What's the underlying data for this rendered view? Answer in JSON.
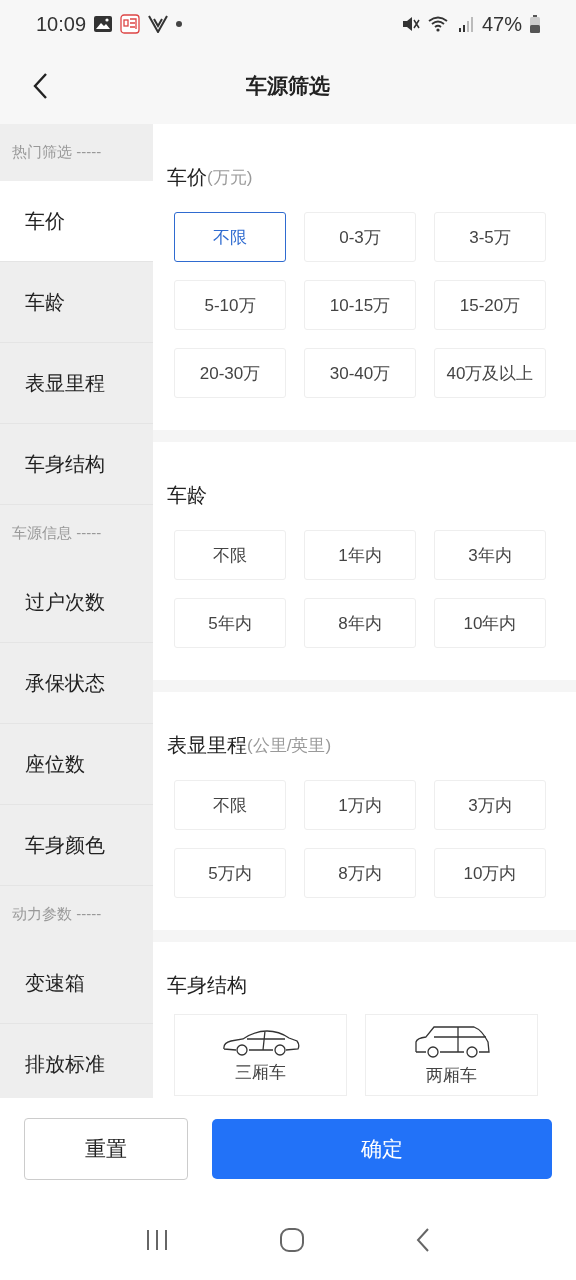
{
  "status_bar": {
    "time": "10:09",
    "battery": "47%"
  },
  "header": {
    "title": "车源筛选"
  },
  "sidebar": {
    "items": [
      {
        "kind": "group",
        "label": "热门筛选 -----"
      },
      {
        "kind": "item",
        "label": "车价",
        "selected": true
      },
      {
        "kind": "item",
        "label": "车龄",
        "selected": false
      },
      {
        "kind": "item",
        "label": "表显里程",
        "selected": false
      },
      {
        "kind": "item",
        "label": "车身结构",
        "selected": false
      },
      {
        "kind": "group",
        "label": "车源信息 -----"
      },
      {
        "kind": "item",
        "label": "过户次数",
        "selected": false
      },
      {
        "kind": "item",
        "label": "承保状态",
        "selected": false
      },
      {
        "kind": "item",
        "label": "座位数",
        "selected": false
      },
      {
        "kind": "item",
        "label": "车身颜色",
        "selected": false
      },
      {
        "kind": "group",
        "label": "动力参数 -----"
      },
      {
        "kind": "item",
        "label": "变速箱",
        "selected": false
      },
      {
        "kind": "item",
        "label": "排放标准",
        "selected": false
      }
    ]
  },
  "sections": [
    {
      "kind": "chips",
      "title": "车价",
      "unit": "(万元)",
      "options": [
        {
          "label": "不限",
          "selected": true
        },
        {
          "label": "0-3万",
          "selected": false
        },
        {
          "label": "3-5万",
          "selected": false
        },
        {
          "label": "5-10万",
          "selected": false
        },
        {
          "label": "10-15万",
          "selected": false
        },
        {
          "label": "15-20万",
          "selected": false
        },
        {
          "label": "20-30万",
          "selected": false
        },
        {
          "label": "30-40万",
          "selected": false
        },
        {
          "label": "40万及以上",
          "selected": false
        }
      ]
    },
    {
      "kind": "chips",
      "title": "车龄",
      "options": [
        {
          "label": "不限",
          "selected": false
        },
        {
          "label": "1年内",
          "selected": false
        },
        {
          "label": "3年内",
          "selected": false
        },
        {
          "label": "5年内",
          "selected": false
        },
        {
          "label": "8年内",
          "selected": false
        },
        {
          "label": "10年内",
          "selected": false
        }
      ]
    },
    {
      "kind": "chips",
      "title": "表显里程",
      "unit": "(公里/英里)",
      "options": [
        {
          "label": "不限",
          "selected": false
        },
        {
          "label": "1万内",
          "selected": false
        },
        {
          "label": "3万内",
          "selected": false
        },
        {
          "label": "5万内",
          "selected": false
        },
        {
          "label": "8万内",
          "selected": false
        },
        {
          "label": "10万内",
          "selected": false
        }
      ]
    },
    {
      "kind": "body_types",
      "title": "车身结构",
      "options": [
        {
          "kind": "sedan",
          "label": "三厢车",
          "selected": false
        },
        {
          "kind": "hatchback",
          "label": "两厢车",
          "selected": false
        }
      ]
    }
  ],
  "footer": {
    "reset": "重置",
    "confirm": "确定"
  }
}
